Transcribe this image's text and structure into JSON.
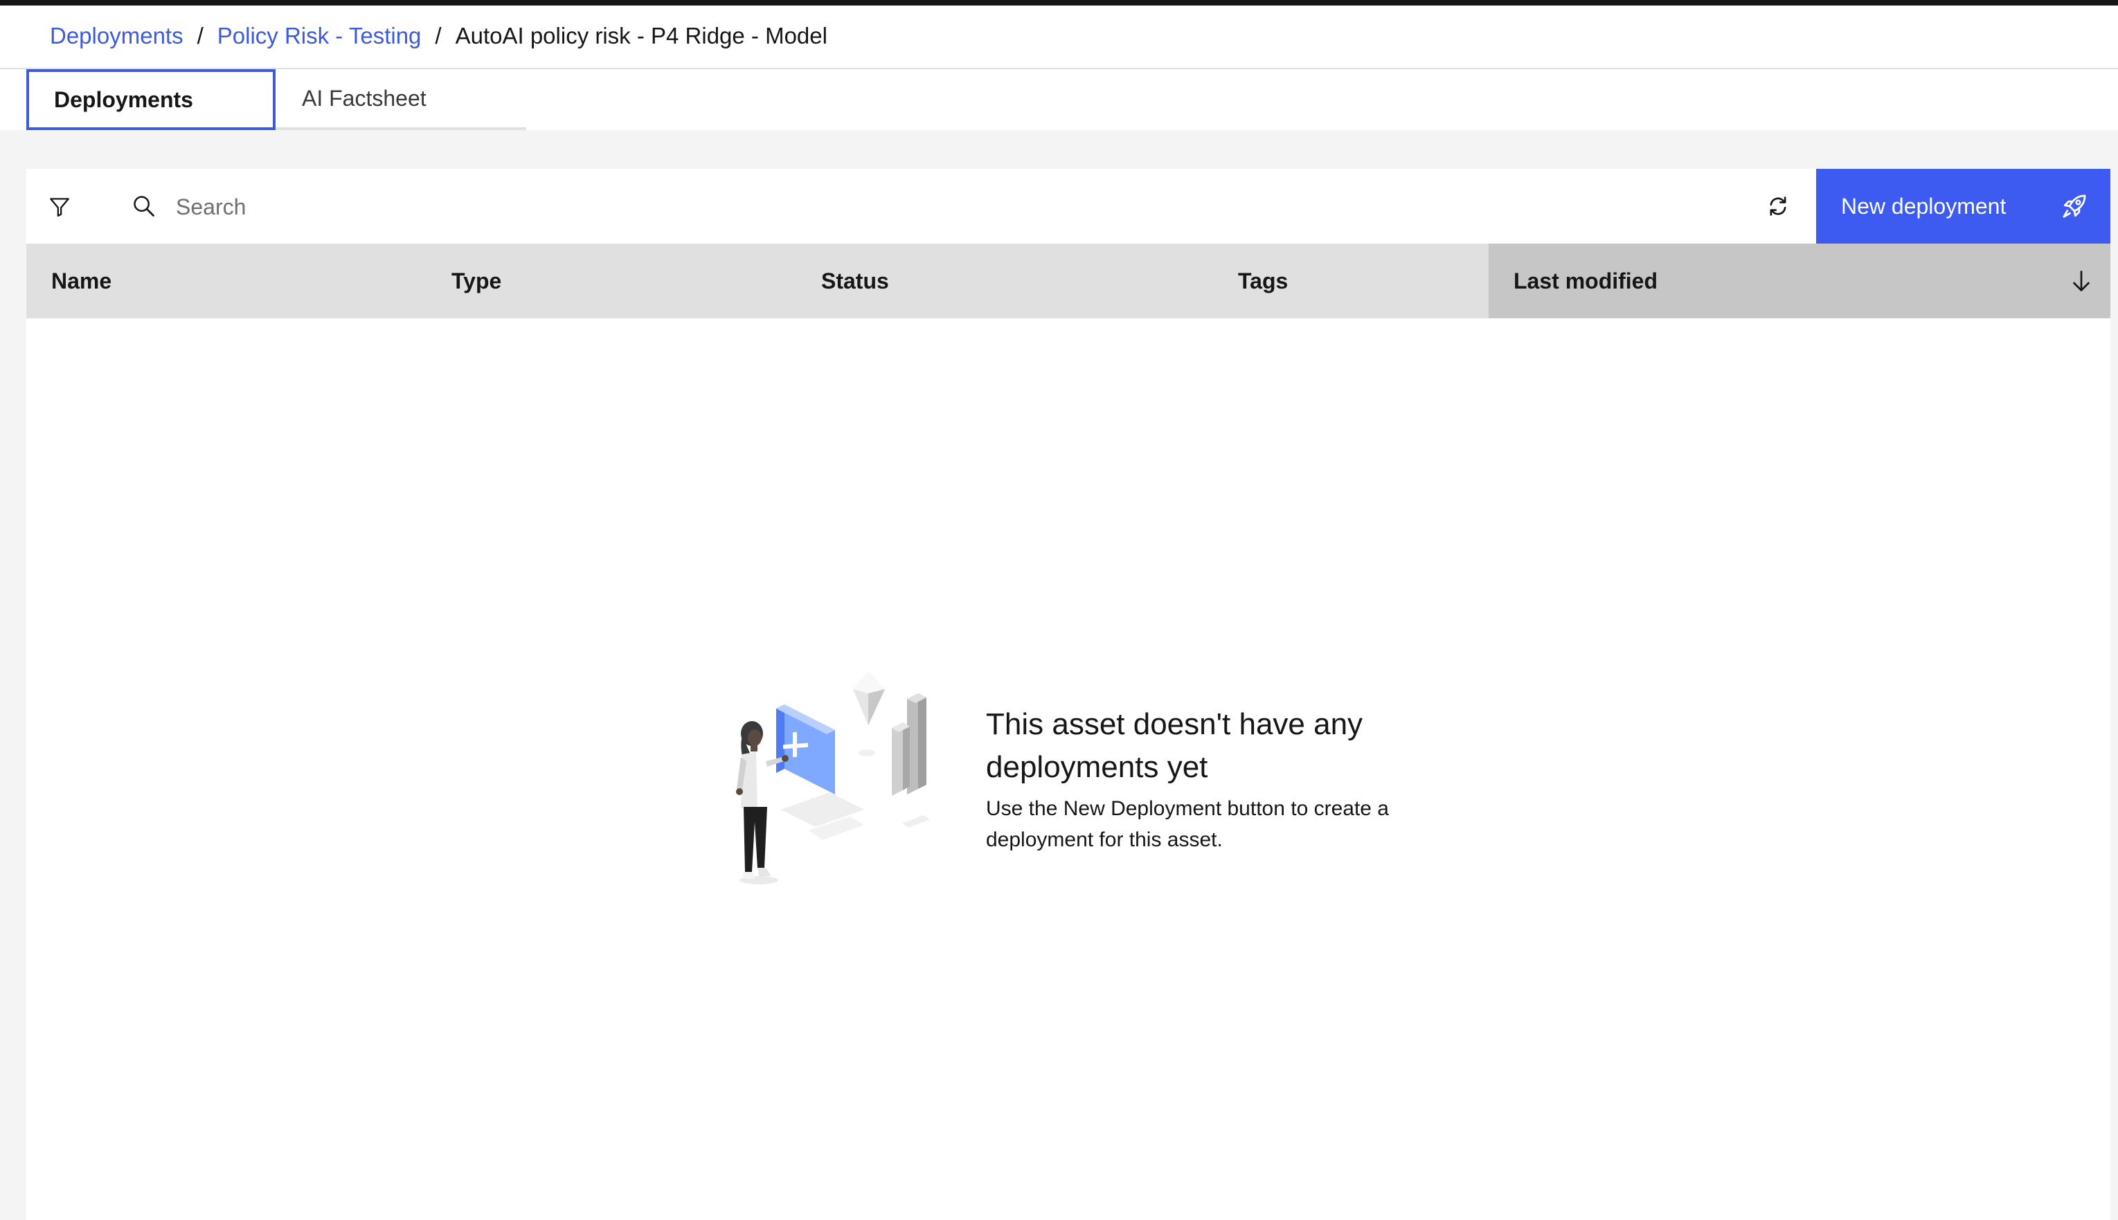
{
  "breadcrumb": {
    "items": [
      "Deployments",
      "Policy Risk - Testing"
    ],
    "separator": "/",
    "current": "AutoAI policy risk - P4 Ridge - Model"
  },
  "tabs": [
    {
      "label": "Deployments",
      "active": true
    },
    {
      "label": "AI Factsheet",
      "active": false
    }
  ],
  "toolbar": {
    "filter_icon": "filter-icon",
    "search_icon": "search-icon",
    "search_placeholder": "Search",
    "search_value": "",
    "refresh_icon": "refresh-icon",
    "new_deployment_label": "New deployment",
    "new_deployment_icon": "rocket-icon"
  },
  "table": {
    "columns": [
      "Name",
      "Type",
      "Status",
      "Tags",
      "Last modified"
    ],
    "sorted_column": "Last modified",
    "sort_direction": "descending",
    "rows": []
  },
  "empty_state": {
    "title": "This asset doesn't have any deployments yet",
    "body": "Use the New Deployment button to create a deployment for this asset."
  },
  "colors": {
    "accent": "#3d5bf0",
    "link": "#3d5bd9",
    "header_bg": "#e0e0e0",
    "sorted_header_bg": "#c6c6c6",
    "page_bg": "#f4f4f4"
  }
}
